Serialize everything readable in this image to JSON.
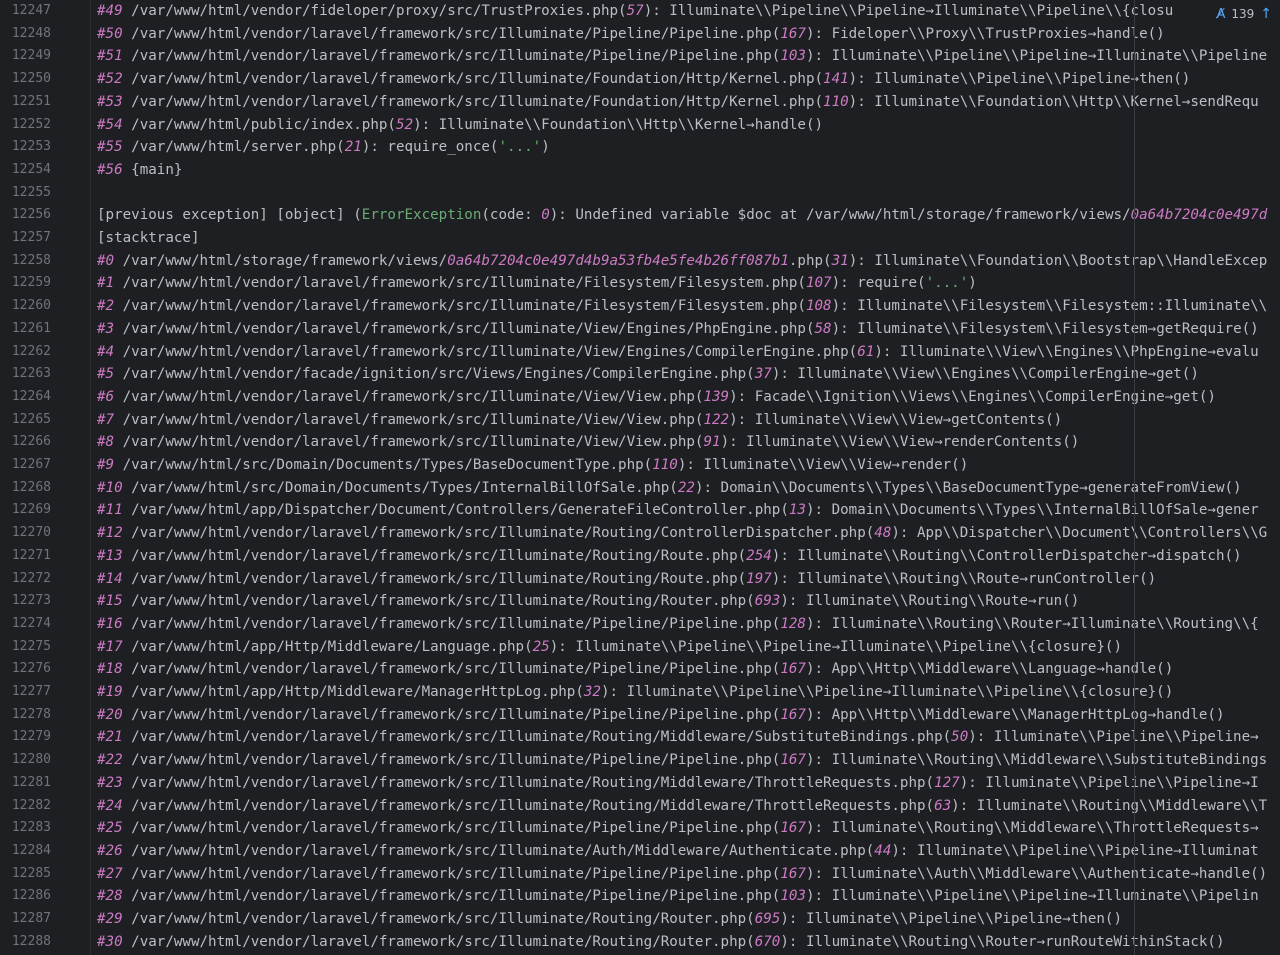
{
  "editor": {
    "inspection_count": "139",
    "lines": [
      {
        "n": "12247",
        "parts": [
          {
            "t": "#49",
            "c": "hash"
          },
          {
            "t": " /var/www/html/vendor/fideloper/proxy/src/TrustProxies.php("
          },
          {
            "t": "57",
            "c": "num"
          },
          {
            "t": "): Illuminate\\\\Pipeline\\\\Pipeline→Illuminate\\\\Pipeline\\\\{closu"
          }
        ]
      },
      {
        "n": "12248",
        "parts": [
          {
            "t": "#50",
            "c": "hash"
          },
          {
            "t": " /var/www/html/vendor/laravel/framework/src/Illuminate/Pipeline/Pipeline.php("
          },
          {
            "t": "167",
            "c": "num"
          },
          {
            "t": "): Fideloper\\\\Proxy\\\\TrustProxies→handle()"
          }
        ]
      },
      {
        "n": "12249",
        "parts": [
          {
            "t": "#51",
            "c": "hash"
          },
          {
            "t": " /var/www/html/vendor/laravel/framework/src/Illuminate/Pipeline/Pipeline.php("
          },
          {
            "t": "103",
            "c": "num"
          },
          {
            "t": "): Illuminate\\\\Pipeline\\\\Pipeline→Illuminate\\\\Pipeline"
          }
        ]
      },
      {
        "n": "12250",
        "parts": [
          {
            "t": "#52",
            "c": "hash"
          },
          {
            "t": " /var/www/html/vendor/laravel/framework/src/Illuminate/Foundation/Http/Kernel.php("
          },
          {
            "t": "141",
            "c": "num"
          },
          {
            "t": "): Illuminate\\\\Pipeline\\\\Pipeline→then()"
          }
        ]
      },
      {
        "n": "12251",
        "parts": [
          {
            "t": "#53",
            "c": "hash"
          },
          {
            "t": " /var/www/html/vendor/laravel/framework/src/Illuminate/Foundation/Http/Kernel.php("
          },
          {
            "t": "110",
            "c": "num"
          },
          {
            "t": "): Illuminate\\\\Foundation\\\\Http\\\\Kernel→sendRequ"
          }
        ]
      },
      {
        "n": "12252",
        "parts": [
          {
            "t": "#54",
            "c": "hash"
          },
          {
            "t": " /var/www/html/public/index.php("
          },
          {
            "t": "52",
            "c": "num"
          },
          {
            "t": "): Illuminate\\\\Foundation\\\\Http\\\\Kernel→handle()"
          }
        ]
      },
      {
        "n": "12253",
        "parts": [
          {
            "t": "#55",
            "c": "hash"
          },
          {
            "t": " /var/www/html/server.php("
          },
          {
            "t": "21",
            "c": "num"
          },
          {
            "t": "): require_once("
          },
          {
            "t": "'...'",
            "c": "str"
          },
          {
            "t": ")"
          }
        ]
      },
      {
        "n": "12254",
        "parts": [
          {
            "t": "#56",
            "c": "hash"
          },
          {
            "t": " {main}"
          }
        ]
      },
      {
        "n": "12255",
        "parts": []
      },
      {
        "n": "12256",
        "parts": [
          {
            "t": "[previous exception] [object] ("
          },
          {
            "t": "ErrorException",
            "c": "cls"
          },
          {
            "t": "(code: "
          },
          {
            "t": "0",
            "c": "num"
          },
          {
            "t": "): Undefined variable $doc at /var/www/html/storage/framework/views/"
          },
          {
            "t": "0a64b7204c0e497d",
            "c": "num"
          }
        ]
      },
      {
        "n": "12257",
        "parts": [
          {
            "t": "[stacktrace]"
          }
        ]
      },
      {
        "n": "12258",
        "parts": [
          {
            "t": "#0",
            "c": "hash"
          },
          {
            "t": " /var/www/html/storage/framework/views/"
          },
          {
            "t": "0a64b7204c0e497d4b9a53fb4e5fe4b26ff087b1",
            "c": "num"
          },
          {
            "t": ".php("
          },
          {
            "t": "31",
            "c": "num"
          },
          {
            "t": "): Illuminate\\\\Foundation\\\\Bootstrap\\\\HandleExcep"
          }
        ]
      },
      {
        "n": "12259",
        "parts": [
          {
            "t": "#1",
            "c": "hash"
          },
          {
            "t": " /var/www/html/vendor/laravel/framework/src/Illuminate/Filesystem/Filesystem.php("
          },
          {
            "t": "107",
            "c": "num"
          },
          {
            "t": "): require("
          },
          {
            "t": "'...'",
            "c": "str"
          },
          {
            "t": ")"
          }
        ]
      },
      {
        "n": "12260",
        "parts": [
          {
            "t": "#2",
            "c": "hash"
          },
          {
            "t": " /var/www/html/vendor/laravel/framework/src/Illuminate/Filesystem/Filesystem.php("
          },
          {
            "t": "108",
            "c": "num"
          },
          {
            "t": "): Illuminate\\\\Filesystem\\\\Filesystem::Illuminate\\\\"
          }
        ]
      },
      {
        "n": "12261",
        "parts": [
          {
            "t": "#3",
            "c": "hash"
          },
          {
            "t": " /var/www/html/vendor/laravel/framework/src/Illuminate/View/Engines/PhpEngine.php("
          },
          {
            "t": "58",
            "c": "num"
          },
          {
            "t": "): Illuminate\\\\Filesystem\\\\Filesystem→getRequire()"
          }
        ]
      },
      {
        "n": "12262",
        "parts": [
          {
            "t": "#4",
            "c": "hash"
          },
          {
            "t": " /var/www/html/vendor/laravel/framework/src/Illuminate/View/Engines/CompilerEngine.php("
          },
          {
            "t": "61",
            "c": "num"
          },
          {
            "t": "): Illuminate\\\\View\\\\Engines\\\\PhpEngine→evalu"
          }
        ]
      },
      {
        "n": "12263",
        "parts": [
          {
            "t": "#5",
            "c": "hash"
          },
          {
            "t": " /var/www/html/vendor/facade/ignition/src/Views/Engines/CompilerEngine.php("
          },
          {
            "t": "37",
            "c": "num"
          },
          {
            "t": "): Illuminate\\\\View\\\\Engines\\\\CompilerEngine→get()"
          }
        ]
      },
      {
        "n": "12264",
        "parts": [
          {
            "t": "#6",
            "c": "hash"
          },
          {
            "t": " /var/www/html/vendor/laravel/framework/src/Illuminate/View/View.php("
          },
          {
            "t": "139",
            "c": "num"
          },
          {
            "t": "): Facade\\\\Ignition\\\\Views\\\\Engines\\\\CompilerEngine→get()"
          }
        ]
      },
      {
        "n": "12265",
        "parts": [
          {
            "t": "#7",
            "c": "hash"
          },
          {
            "t": " /var/www/html/vendor/laravel/framework/src/Illuminate/View/View.php("
          },
          {
            "t": "122",
            "c": "num"
          },
          {
            "t": "): Illuminate\\\\View\\\\View→getContents()"
          }
        ]
      },
      {
        "n": "12266",
        "parts": [
          {
            "t": "#8",
            "c": "hash"
          },
          {
            "t": " /var/www/html/vendor/laravel/framework/src/Illuminate/View/View.php("
          },
          {
            "t": "91",
            "c": "num"
          },
          {
            "t": "): Illuminate\\\\View\\\\View→renderContents()"
          }
        ]
      },
      {
        "n": "12267",
        "parts": [
          {
            "t": "#9",
            "c": "hash"
          },
          {
            "t": " /var/www/html/src/Domain/Documents/Types/BaseDocumentType.php("
          },
          {
            "t": "110",
            "c": "num"
          },
          {
            "t": "): Illuminate\\\\View\\\\View→render()"
          }
        ]
      },
      {
        "n": "12268",
        "parts": [
          {
            "t": "#10",
            "c": "hash"
          },
          {
            "t": " /var/www/html/src/Domain/Documents/Types/InternalBillOfSale.php("
          },
          {
            "t": "22",
            "c": "num"
          },
          {
            "t": "): Domain\\\\Documents\\\\Types\\\\BaseDocumentType→generateFromView()"
          }
        ]
      },
      {
        "n": "12269",
        "parts": [
          {
            "t": "#11",
            "c": "hash"
          },
          {
            "t": " /var/www/html/app/Dispatcher/Document/Controllers/GenerateFileController.php("
          },
          {
            "t": "13",
            "c": "num"
          },
          {
            "t": "): Domain\\\\Documents\\\\Types\\\\InternalBillOfSale→gener"
          }
        ]
      },
      {
        "n": "12270",
        "parts": [
          {
            "t": "#12",
            "c": "hash"
          },
          {
            "t": " /var/www/html/vendor/laravel/framework/src/Illuminate/Routing/ControllerDispatcher.php("
          },
          {
            "t": "48",
            "c": "num"
          },
          {
            "t": "): App\\\\Dispatcher\\\\Document\\\\Controllers\\\\G"
          }
        ]
      },
      {
        "n": "12271",
        "parts": [
          {
            "t": "#13",
            "c": "hash"
          },
          {
            "t": " /var/www/html/vendor/laravel/framework/src/Illuminate/Routing/Route.php("
          },
          {
            "t": "254",
            "c": "num"
          },
          {
            "t": "): Illuminate\\\\Routing\\\\ControllerDispatcher→dispatch()"
          }
        ]
      },
      {
        "n": "12272",
        "parts": [
          {
            "t": "#14",
            "c": "hash"
          },
          {
            "t": " /var/www/html/vendor/laravel/framework/src/Illuminate/Routing/Route.php("
          },
          {
            "t": "197",
            "c": "num"
          },
          {
            "t": "): Illuminate\\\\Routing\\\\Route→runController()"
          }
        ]
      },
      {
        "n": "12273",
        "parts": [
          {
            "t": "#15",
            "c": "hash"
          },
          {
            "t": " /var/www/html/vendor/laravel/framework/src/Illuminate/Routing/Router.php("
          },
          {
            "t": "693",
            "c": "num"
          },
          {
            "t": "): Illuminate\\\\Routing\\\\Route→run()"
          }
        ]
      },
      {
        "n": "12274",
        "parts": [
          {
            "t": "#16",
            "c": "hash"
          },
          {
            "t": " /var/www/html/vendor/laravel/framework/src/Illuminate/Pipeline/Pipeline.php("
          },
          {
            "t": "128",
            "c": "num"
          },
          {
            "t": "): Illuminate\\\\Routing\\\\Router→Illuminate\\\\Routing\\\\{"
          }
        ]
      },
      {
        "n": "12275",
        "parts": [
          {
            "t": "#17",
            "c": "hash"
          },
          {
            "t": " /var/www/html/app/Http/Middleware/Language.php("
          },
          {
            "t": "25",
            "c": "num"
          },
          {
            "t": "): Illuminate\\\\Pipeline\\\\Pipeline→Illuminate\\\\Pipeline\\\\{closure}()"
          }
        ]
      },
      {
        "n": "12276",
        "parts": [
          {
            "t": "#18",
            "c": "hash"
          },
          {
            "t": " /var/www/html/vendor/laravel/framework/src/Illuminate/Pipeline/Pipeline.php("
          },
          {
            "t": "167",
            "c": "num"
          },
          {
            "t": "): App\\\\Http\\\\Middleware\\\\Language→handle()"
          }
        ]
      },
      {
        "n": "12277",
        "parts": [
          {
            "t": "#19",
            "c": "hash"
          },
          {
            "t": " /var/www/html/app/Http/Middleware/ManagerHttpLog.php("
          },
          {
            "t": "32",
            "c": "num"
          },
          {
            "t": "): Illuminate\\\\Pipeline\\\\Pipeline→Illuminate\\\\Pipeline\\\\{closure}()"
          }
        ]
      },
      {
        "n": "12278",
        "parts": [
          {
            "t": "#20",
            "c": "hash"
          },
          {
            "t": " /var/www/html/vendor/laravel/framework/src/Illuminate/Pipeline/Pipeline.php("
          },
          {
            "t": "167",
            "c": "num"
          },
          {
            "t": "): App\\\\Http\\\\Middleware\\\\ManagerHttpLog→handle()"
          }
        ]
      },
      {
        "n": "12279",
        "parts": [
          {
            "t": "#21",
            "c": "hash"
          },
          {
            "t": " /var/www/html/vendor/laravel/framework/src/Illuminate/Routing/Middleware/SubstituteBindings.php("
          },
          {
            "t": "50",
            "c": "num"
          },
          {
            "t": "): Illuminate\\\\Pipeline\\\\Pipeline→"
          }
        ]
      },
      {
        "n": "12280",
        "parts": [
          {
            "t": "#22",
            "c": "hash"
          },
          {
            "t": " /var/www/html/vendor/laravel/framework/src/Illuminate/Pipeline/Pipeline.php("
          },
          {
            "t": "167",
            "c": "num"
          },
          {
            "t": "): Illuminate\\\\Routing\\\\Middleware\\\\SubstituteBindings"
          }
        ]
      },
      {
        "n": "12281",
        "parts": [
          {
            "t": "#23",
            "c": "hash"
          },
          {
            "t": " /var/www/html/vendor/laravel/framework/src/Illuminate/Routing/Middleware/ThrottleRequests.php("
          },
          {
            "t": "127",
            "c": "num"
          },
          {
            "t": "): Illuminate\\\\Pipeline\\\\Pipeline→I"
          }
        ]
      },
      {
        "n": "12282",
        "parts": [
          {
            "t": "#24",
            "c": "hash"
          },
          {
            "t": " /var/www/html/vendor/laravel/framework/src/Illuminate/Routing/Middleware/ThrottleRequests.php("
          },
          {
            "t": "63",
            "c": "num"
          },
          {
            "t": "): Illuminate\\\\Routing\\\\Middleware\\\\T"
          }
        ]
      },
      {
        "n": "12283",
        "parts": [
          {
            "t": "#25",
            "c": "hash"
          },
          {
            "t": " /var/www/html/vendor/laravel/framework/src/Illuminate/Pipeline/Pipeline.php("
          },
          {
            "t": "167",
            "c": "num"
          },
          {
            "t": "): Illuminate\\\\Routing\\\\Middleware\\\\ThrottleRequests→"
          }
        ]
      },
      {
        "n": "12284",
        "parts": [
          {
            "t": "#26",
            "c": "hash"
          },
          {
            "t": " /var/www/html/vendor/laravel/framework/src/Illuminate/Auth/Middleware/Authenticate.php("
          },
          {
            "t": "44",
            "c": "num"
          },
          {
            "t": "): Illuminate\\\\Pipeline\\\\Pipeline→Illuminat"
          }
        ]
      },
      {
        "n": "12285",
        "parts": [
          {
            "t": "#27",
            "c": "hash"
          },
          {
            "t": " /var/www/html/vendor/laravel/framework/src/Illuminate/Pipeline/Pipeline.php("
          },
          {
            "t": "167",
            "c": "num"
          },
          {
            "t": "): Illuminate\\\\Auth\\\\Middleware\\\\Authenticate→handle()"
          }
        ]
      },
      {
        "n": "12286",
        "parts": [
          {
            "t": "#28",
            "c": "hash"
          },
          {
            "t": " /var/www/html/vendor/laravel/framework/src/Illuminate/Pipeline/Pipeline.php("
          },
          {
            "t": "103",
            "c": "num"
          },
          {
            "t": "): Illuminate\\\\Pipeline\\\\Pipeline→Illuminate\\\\Pipelin"
          }
        ]
      },
      {
        "n": "12287",
        "parts": [
          {
            "t": "#29",
            "c": "hash"
          },
          {
            "t": " /var/www/html/vendor/laravel/framework/src/Illuminate/Routing/Router.php("
          },
          {
            "t": "695",
            "c": "num"
          },
          {
            "t": "): Illuminate\\\\Pipeline\\\\Pipeline→then()"
          }
        ]
      },
      {
        "n": "12288",
        "parts": [
          {
            "t": "#30",
            "c": "hash"
          },
          {
            "t": " /var/www/html/vendor/laravel/framework/src/Illuminate/Routing/Router.php("
          },
          {
            "t": "670",
            "c": "num"
          },
          {
            "t": "): Illuminate\\\\Routing\\\\Router→runRouteWithinStack()"
          }
        ]
      }
    ]
  },
  "colors": {
    "background": "#1e1f22",
    "text": "#bcbec4",
    "line_number": "#6f737a",
    "number": "#cc7ac4",
    "string": "#6aab73",
    "accent": "#56a8f5"
  },
  "icons": {
    "inspection": "typo-check-icon",
    "navigate_up": "arrow-up-icon"
  }
}
